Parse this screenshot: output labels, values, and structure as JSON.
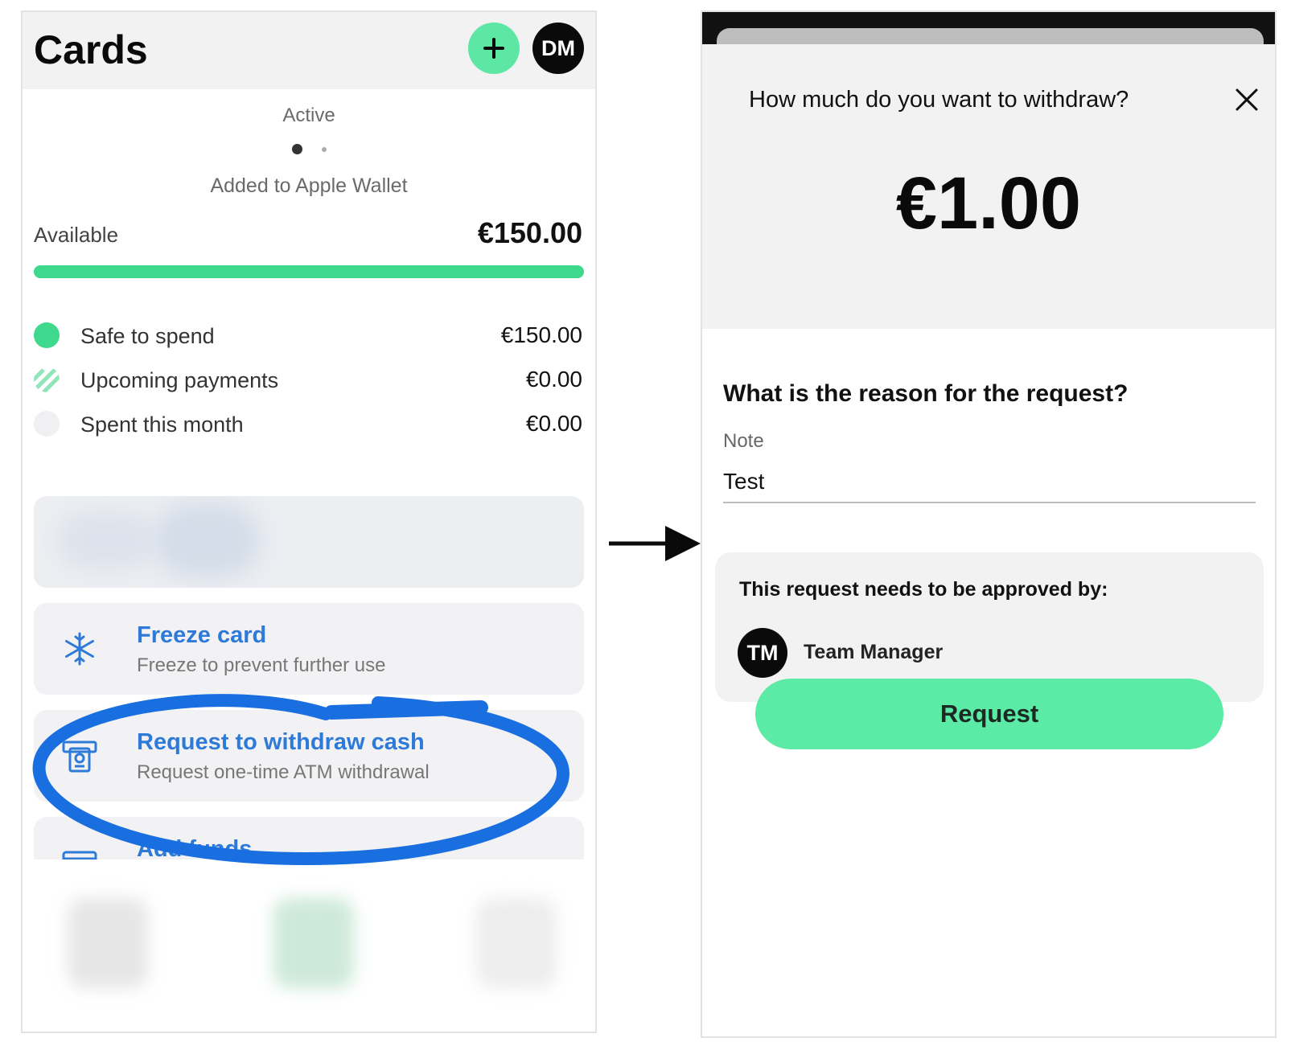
{
  "left_screen": {
    "header": {
      "title": "Cards",
      "add_icon": "plus-icon",
      "avatar_initials": "DM"
    },
    "card_status": "Active",
    "wallet_status": "Added to Apple Wallet",
    "available": {
      "label": "Available",
      "value": "€150.00",
      "fill_fraction": 1.0
    },
    "legend": [
      {
        "label": "Safe to spend",
        "value": "€150.00",
        "color": "#3ed98c"
      },
      {
        "label": "Upcoming payments",
        "value": "€0.00",
        "color": "#8fe6b8"
      },
      {
        "label": "Spent this month",
        "value": "€0.00",
        "color": "#f0f0f2"
      }
    ],
    "actions": [
      {
        "title": "Freeze card",
        "subtitle": "Freeze to prevent further use",
        "icon": "snowflake-icon"
      },
      {
        "title": "Request to withdraw cash",
        "subtitle": "Request one-time ATM withdrawal",
        "icon": "atm-cash-icon"
      },
      {
        "title": "Add funds",
        "subtitle": "",
        "icon": "add-funds-icon"
      }
    ],
    "accent_color": "#2e7ad8",
    "highlight_color": "#1a6fe0"
  },
  "right_screen": {
    "question": "How much do you want to withdraw?",
    "close_icon": "close-icon",
    "amount": "€1.00",
    "reason_question": "What is the reason for the request?",
    "note": {
      "label": "Note",
      "value": "Test"
    },
    "approval": {
      "title": "This request needs to be approved by:",
      "approver_initials": "TM",
      "approver_name": "Team Manager"
    },
    "request_button": "Request",
    "brand_color": "#5ceba6"
  },
  "arrow_icon": "arrow-right-icon"
}
